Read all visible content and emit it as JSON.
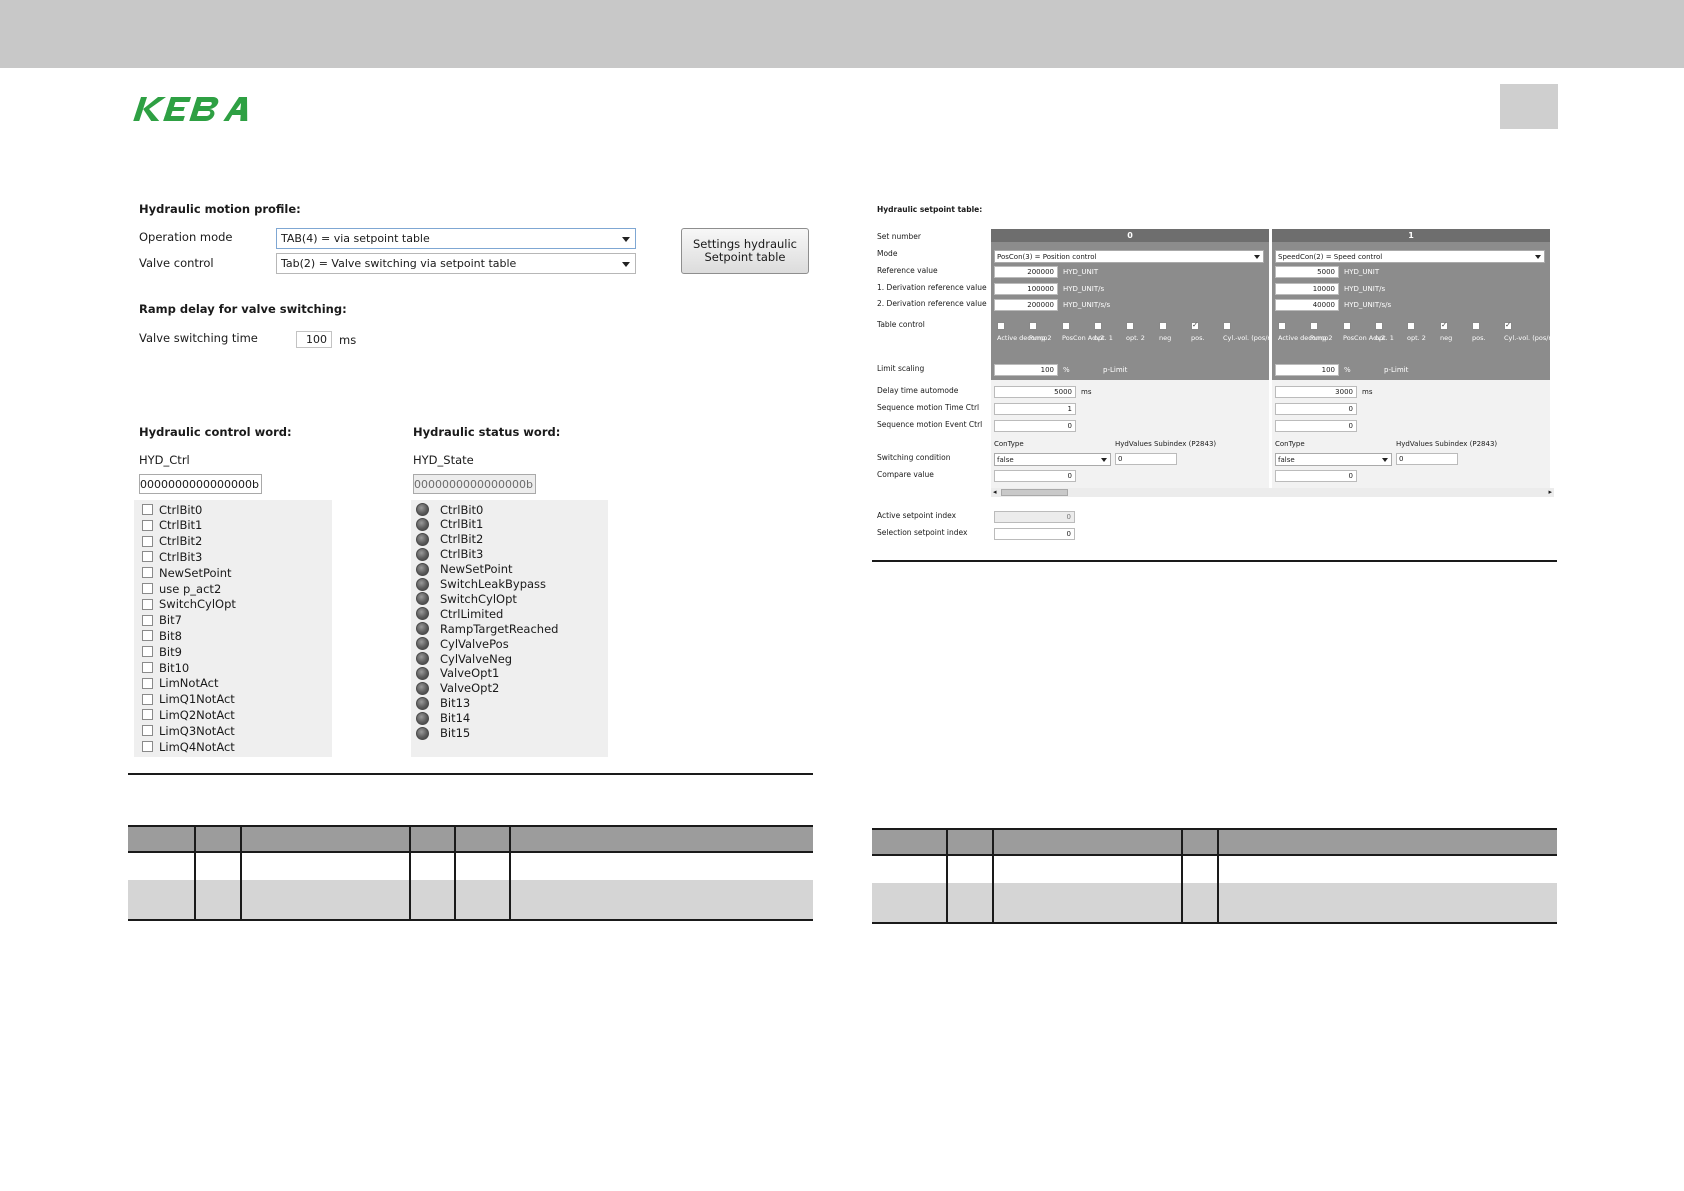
{
  "brand": {
    "logo_text": "KEBA",
    "logo_color": "#2ea043"
  },
  "motion_profile": {
    "heading": "Hydraulic motion profile:",
    "operation_mode_label": "Operation mode",
    "operation_mode_value": "TAB(4) = via setpoint table",
    "valve_control_label": "Valve control",
    "valve_control_value": "Tab(2) = Valve switching via setpoint table",
    "settings_button_line1": "Settings hydraulic",
    "settings_button_line2": "Setpoint table"
  },
  "ramp_delay": {
    "heading": "Ramp delay for valve switching:",
    "label": "Valve switching time",
    "value": "100",
    "unit": "ms"
  },
  "control_word": {
    "heading": "Hydraulic control word:",
    "var_name": "HYD_Ctrl",
    "value": "0000000000000000b",
    "bits": [
      "CtrlBit0",
      "CtrlBit1",
      "CtrlBit2",
      "CtrlBit3",
      "NewSetPoint",
      "use p_act2",
      "SwitchCylOpt",
      "Bit7",
      "Bit8",
      "Bit9",
      "Bit10",
      "LimNotAct",
      "LimQ1NotAct",
      "LimQ2NotAct",
      "LimQ3NotAct",
      "LimQ4NotAct"
    ]
  },
  "status_word": {
    "heading": "Hydraulic status word:",
    "var_name": "HYD_State",
    "value": "0000000000000000b",
    "bits": [
      "CtrlBit0",
      "CtrlBit1",
      "CtrlBit2",
      "CtrlBit3",
      "NewSetPoint",
      "SwitchLeakBypass",
      "SwitchCylOpt",
      "CtrlLimited",
      "RampTargetReached",
      "CylValvePos",
      "CylValveNeg",
      "ValveOpt1",
      "ValveOpt2",
      "Bit13",
      "Bit14",
      "Bit15"
    ]
  },
  "setpoint_table": {
    "heading": "Hydraulic setpoint table:",
    "row_labels": {
      "set_number": "Set number",
      "mode": "Mode",
      "reference_value": "Reference value",
      "deriv1": "1. Derivation reference value",
      "deriv2": "2. Derivation reference value",
      "table_control": "Table control",
      "limit_scaling": "Limit scaling",
      "delay_time": "Delay time automode",
      "seq_time": "Sequence motion Time Ctrl",
      "seq_event": "Sequence motion Event Ctrl",
      "switching_condition": "Switching condition",
      "compare_value": "Compare value",
      "active_index": "Active setpoint index",
      "selection_index": "Selection setpoint index"
    },
    "control_flag_labels": [
      "Active decomp",
      "Pump2",
      "PosCon Adv2",
      "opt. 1",
      "opt. 2",
      "neg",
      "pos.",
      "Cyl.-vol. (pos/neg)"
    ],
    "contype_label": "ConType",
    "subindex_label": "HydValues Subindex (P2843)",
    "units": {
      "ref": "HYD_UNIT",
      "d1": "HYD_UNIT/s",
      "d2": "HYD_UNIT/s/s",
      "percent": "%",
      "plimit": "p-Limit",
      "ms": "ms"
    },
    "columns": [
      {
        "number": "0",
        "mode": "PosCon(3) = Position control",
        "reference": "200000",
        "deriv1": "100000",
        "deriv2": "200000",
        "flags": [
          false,
          false,
          false,
          false,
          false,
          false,
          true,
          false
        ],
        "limit_scaling": "100",
        "delay": "5000",
        "seq_time": "1",
        "seq_event": "0",
        "contype": "false",
        "subindex": "0",
        "compare": "0"
      },
      {
        "number": "1",
        "mode": "SpeedCon(2) = Speed control",
        "reference": "5000",
        "deriv1": "10000",
        "deriv2": "40000",
        "flags": [
          false,
          false,
          false,
          false,
          false,
          true,
          false,
          true
        ],
        "limit_scaling": "100",
        "delay": "3000",
        "seq_time": "0",
        "seq_event": "0",
        "contype": "false",
        "subindex": "0",
        "compare": "0"
      }
    ],
    "active_index_value": "0",
    "selection_index_value": "0"
  }
}
